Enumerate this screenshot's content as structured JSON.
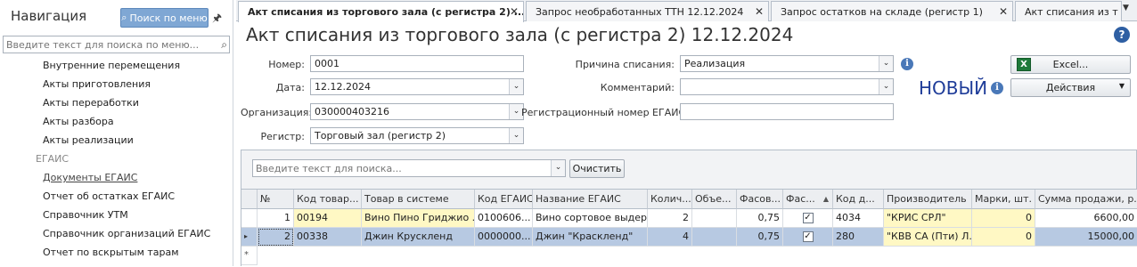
{
  "sidebar": {
    "title": "Навигация",
    "search_button": "Поиск по меню",
    "search_placeholder": "Введите текст для поиска по меню...",
    "items": [
      "Внутренние перемещения",
      "Акты приготовления",
      "Акты переработки",
      "Акты разбора",
      "Акты реализации",
      "ЕГАИС",
      "Документы ЕГАИС",
      "Отчет об остатках ЕГАИС",
      "Справочник УТМ",
      "Справочник организаций ЕГАИС",
      "Отчет по вскрытым тарам"
    ]
  },
  "tabs": [
    "Акт списания из торгового зала (с регистра 2)  ...",
    "Запрос необработанных ТТН 12.12.2024",
    "Запрос остатков на складе (регистр 1)",
    "Акт списания из т"
  ],
  "form": {
    "title": "Акт списания из торгового зала (с регистра 2)  12.12.2024",
    "number_label": "Номер:",
    "number_value": "0001",
    "date_label": "Дата:",
    "date_value": "12.12.2024",
    "org_label": "Организация:",
    "org_value": "030000403216",
    "register_label": "Регистр:",
    "register_value": "Торговый зал (регистр 2)",
    "reason_label": "Причина списания:",
    "reason_value": "Реализация",
    "comment_label": "Комментарий:",
    "comment_value": "",
    "egais_reg_label": "Регистрационный номер ЕГАИС:",
    "egais_reg_value": "",
    "status": "НОВЫЙ",
    "excel_button": "Excel...",
    "actions_button": "Действия"
  },
  "grid": {
    "search_placeholder": "Введите текст для поиска...",
    "clear_button": "Очистить",
    "columns": [
      "№",
      "Код товар...",
      "Товар в системе",
      "Код ЕГАИС",
      "Название ЕГАИС",
      "Колич...",
      "Объе...",
      "Фасов...",
      "Фас...",
      "Код д...",
      "Производитель",
      "Марки, шт.",
      "Сумма продажи, р."
    ],
    "rows": [
      {
        "n": "1",
        "code": "00194",
        "product": "Вино Пино Гриджио ...",
        "egais_code": "0100606...",
        "egais_name": "Вино сортовое выдер...",
        "qty": "2",
        "vol": "",
        "pack": "0,75",
        "packed": true,
        "kod": "4034",
        "producer": "\"КРИС СРЛ\"",
        "marks": "0",
        "sum": "6600,00"
      },
      {
        "n": "2",
        "code": "00338",
        "product": "Джин Крускленд",
        "egais_code": "0000000...",
        "egais_name": "Джин \"Краскленд\"",
        "qty": "4",
        "vol": "",
        "pack": "0,75",
        "packed": true,
        "kod": "280",
        "producer": "\"КВВ СА (Пти) Л...",
        "marks": "0",
        "sum": "15000,00"
      }
    ]
  },
  "colors": {
    "accent": "#7fa7d4",
    "selected_row": "#b7c9e2",
    "highlight": "#fff8c4",
    "status": "#1f3d99"
  }
}
